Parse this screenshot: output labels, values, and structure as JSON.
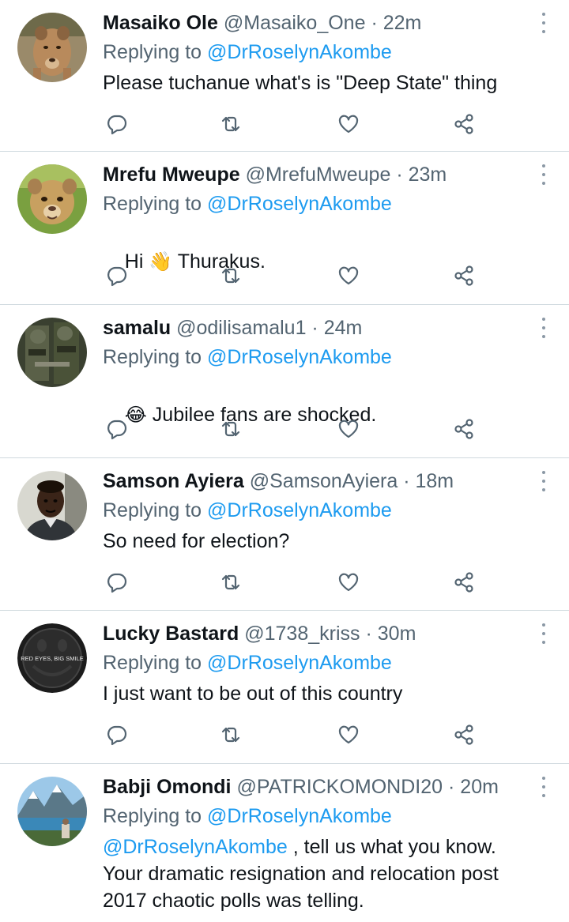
{
  "colors": {
    "accent": "#1d9bf0",
    "muted": "#536471",
    "text": "#0f1419",
    "divider": "#cfd9de"
  },
  "icons": {
    "reply": "comment-bubble-icon",
    "retweet": "retweet-arrows-icon",
    "like": "heart-icon",
    "share": "share-nodes-icon",
    "menu": "vertical-ellipsis-icon"
  },
  "tweets": [
    {
      "name": "Masaiko Ole",
      "handle": "@Masaiko_One",
      "dot": "·",
      "time": "22m",
      "replying_prefix": "Replying to",
      "replying_to": "@DrRoselynAkombe",
      "body_pre": "",
      "body_emoji": "",
      "body_text": "Please tuchanue what's is \"Deep State\"  thing",
      "avatar": "lioness-avatar"
    },
    {
      "name": "Mrefu Mweupe",
      "handle": "@MrefuMweupe",
      "dot": "·",
      "time": "23m",
      "replying_prefix": "Replying to",
      "replying_to": "@DrRoselynAkombe",
      "body_pre": "Hi ",
      "body_emoji": "👋",
      "body_text": " Thurakus.",
      "avatar": "lion-cub-avatar"
    },
    {
      "name": "samalu",
      "handle": "@odilisamalu1",
      "dot": "·",
      "time": "24m",
      "replying_prefix": "Replying to",
      "replying_to": "@DrRoselynAkombe",
      "body_pre": "",
      "body_emoji": "😂",
      "body_text": " Jubilee fans are shocked.",
      "avatar": "soldier-avatar"
    },
    {
      "name": "Samson Ayiera",
      "handle": "@SamsonAyiera",
      "dot": "·",
      "time": "18m",
      "replying_prefix": "Replying to",
      "replying_to": "@DrRoselynAkombe",
      "body_pre": "",
      "body_emoji": "",
      "body_text": "So need for election?",
      "avatar": "person-avatar"
    },
    {
      "name": "Lucky Bastard",
      "handle": "@1738_kriss",
      "dot": "·",
      "time": "30m",
      "replying_prefix": "Replying to",
      "replying_to": "@DrRoselynAkombe",
      "body_pre": "",
      "body_emoji": "",
      "body_text": "I just want to be out of this country",
      "avatar_text": "RED EYES, BIG SMILE",
      "avatar": "smiley-badge-avatar"
    },
    {
      "name": "Babji Omondi",
      "handle": "@PATRICKOMONDI20",
      "dot": "·",
      "time": "20m",
      "replying_prefix": "Replying to",
      "replying_to": "@DrRoselynAkombe",
      "body_mention": "@DrRoselynAkombe",
      "body_text": " , tell us what you know.",
      "body_line2": "Your dramatic resignation and relocation post",
      "body_line3": "2017 chaotic polls was telling.",
      "avatar": "mountain-lake-avatar"
    }
  ]
}
